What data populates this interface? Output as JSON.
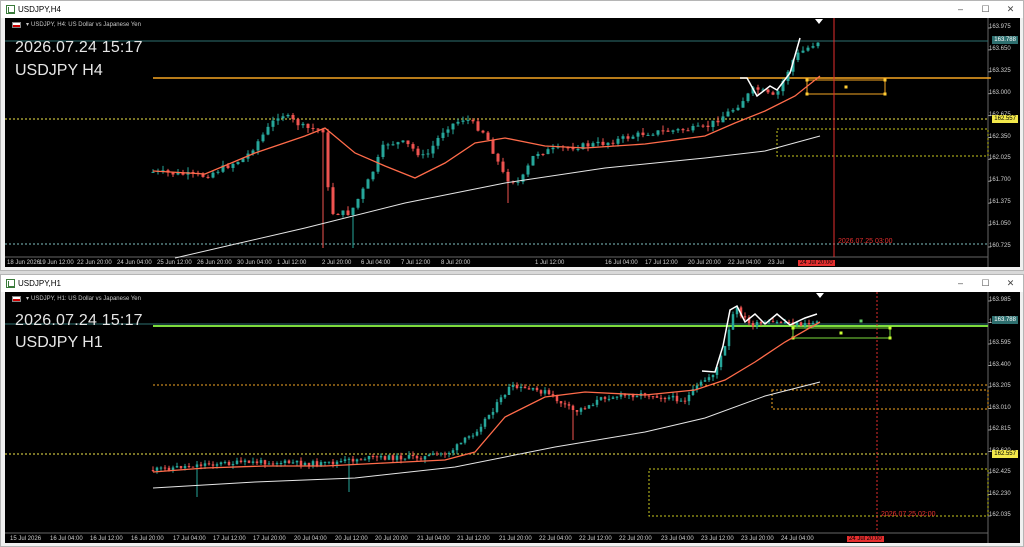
{
  "windows": [
    {
      "title": "USDJPY,H4",
      "ticker": "USDJPY, H4:",
      "ticker_desc": "US Dollar vs Japanese Yen",
      "overlay_time": "2026.07.24 15:17",
      "overlay_symbol": "USDJPY H4",
      "price_labels": [
        "163.975",
        "163.650",
        "163.325",
        "163.000",
        "162.675",
        "162.350",
        "162.025",
        "161.700",
        "161.375",
        "161.050",
        "160.725"
      ],
      "price_tags": [
        {
          "text": "163.788",
          "bg": "#2e6f6f",
          "fg": "#ffffff"
        },
        {
          "text": "162.557",
          "bg": "#f2e84b",
          "fg": "#000000"
        }
      ],
      "time_labels": [
        "18 Jun 2026",
        "19 Jun 12:00",
        "22 Jun 20:00",
        "24 Jun 04:00",
        "25 Jun 12:00",
        "26 Jun 20:00",
        "30 Jun 04:00",
        "1 Jul 12:00",
        "2 Jul 20:00",
        "6 Jul 04:00",
        "7 Jul 12:00",
        "8 Jul 20:00",
        "1 Jul 12:00",
        "16 Jul 04:00",
        "17 Jul 12:00",
        "20 Jul 20:00",
        "22 Jul 04:00",
        "23 Jul",
        "24 Jul 20:00"
      ],
      "vline_tag": "2026.07.24 20:00",
      "vline_text": "2026.07.25 03:00"
    },
    {
      "title": "USDJPY,H1",
      "ticker": "USDJPY, H1:",
      "ticker_desc": "US Dollar vs Japanese Yen",
      "overlay_time": "2026.07.24 15:17",
      "overlay_symbol": "USDJPY H1",
      "price_labels": [
        "163.985",
        "163.790",
        "163.595",
        "163.400",
        "163.205",
        "163.010",
        "162.815",
        "162.620",
        "162.425",
        "162.230",
        "162.035"
      ],
      "price_tags": [
        {
          "text": "163.788",
          "bg": "#2e6f6f",
          "fg": "#ffffff"
        },
        {
          "text": "162.557",
          "bg": "#f2e84b",
          "fg": "#000000"
        }
      ],
      "time_labels": [
        "15 Jul 2026",
        "16 Jul 04:00",
        "16 Jul 12:00",
        "16 Jul 20:00",
        "17 Jul 04:00",
        "17 Jul 12:00",
        "17 Jul 20:00",
        "20 Jul 04:00",
        "20 Jul 12:00",
        "20 Jul 20:00",
        "21 Jul 04:00",
        "21 Jul 12:00",
        "21 Jul 20:00",
        "22 Jul 04:00",
        "22 Jul 12:00",
        "22 Jul 20:00",
        "23 Jul 04:00",
        "23 Jul 12:00",
        "23 Jul 20:00",
        "24 Jul 04:00",
        "24 Jul 20:00"
      ],
      "vline_tag": "2026.07.24 20:00",
      "vline_text": "2026.07.25 02:00"
    }
  ],
  "window_controls": {
    "minimize": "–",
    "maximize": "☐",
    "close": "✕"
  },
  "colors": {
    "bull": "#26a69a",
    "bear": "#ef5350",
    "ma_fast": "#ff6b4a",
    "ma_slow": "#e6e6e6",
    "level_orange": "#f5a623",
    "level_green": "#7ddc3c",
    "dotted": "#c8a020",
    "vline": "#e52e2e"
  }
}
